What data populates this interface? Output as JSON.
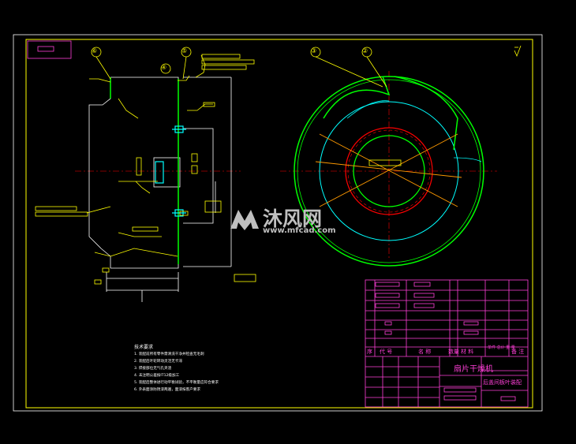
{
  "drawing": {
    "balloons": [
      "⑥",
      "⑤",
      "④",
      "③",
      "②"
    ],
    "title_block": {
      "title": "扇片干燥机",
      "subtitle": "后盖间板叶装配",
      "header_labels": [
        "序",
        "代 号",
        "名 称",
        "数量",
        "材 料",
        "单件 总计 重 量",
        "备 注"
      ]
    },
    "notes": {
      "heading": "技术要求",
      "lines": [
        "1. 装配前所有零件需清洗干净并检查无毛刺",
        "2. 装配后叶轮转动灵活无卡滞",
        "3. 焊接部位无气孔夹渣",
        "4. 未注明公差按IT12级加工",
        "5. 装配后整体进行动平衡试验，不平衡量应符合要求",
        "6. 外表面涂防锈漆两遍，面漆按客户要求"
      ]
    },
    "watermark": {
      "brand": "沐风网",
      "url": "www.mfcad.com"
    },
    "colors": {
      "frame": "#ffff00",
      "outline": "#ffffff",
      "green": "#00ff00",
      "cyan": "#00ffff",
      "red": "#ff0000",
      "magenta": "#ff3fd8",
      "orange": "#ff9a00",
      "yellow": "#ffff00"
    }
  }
}
